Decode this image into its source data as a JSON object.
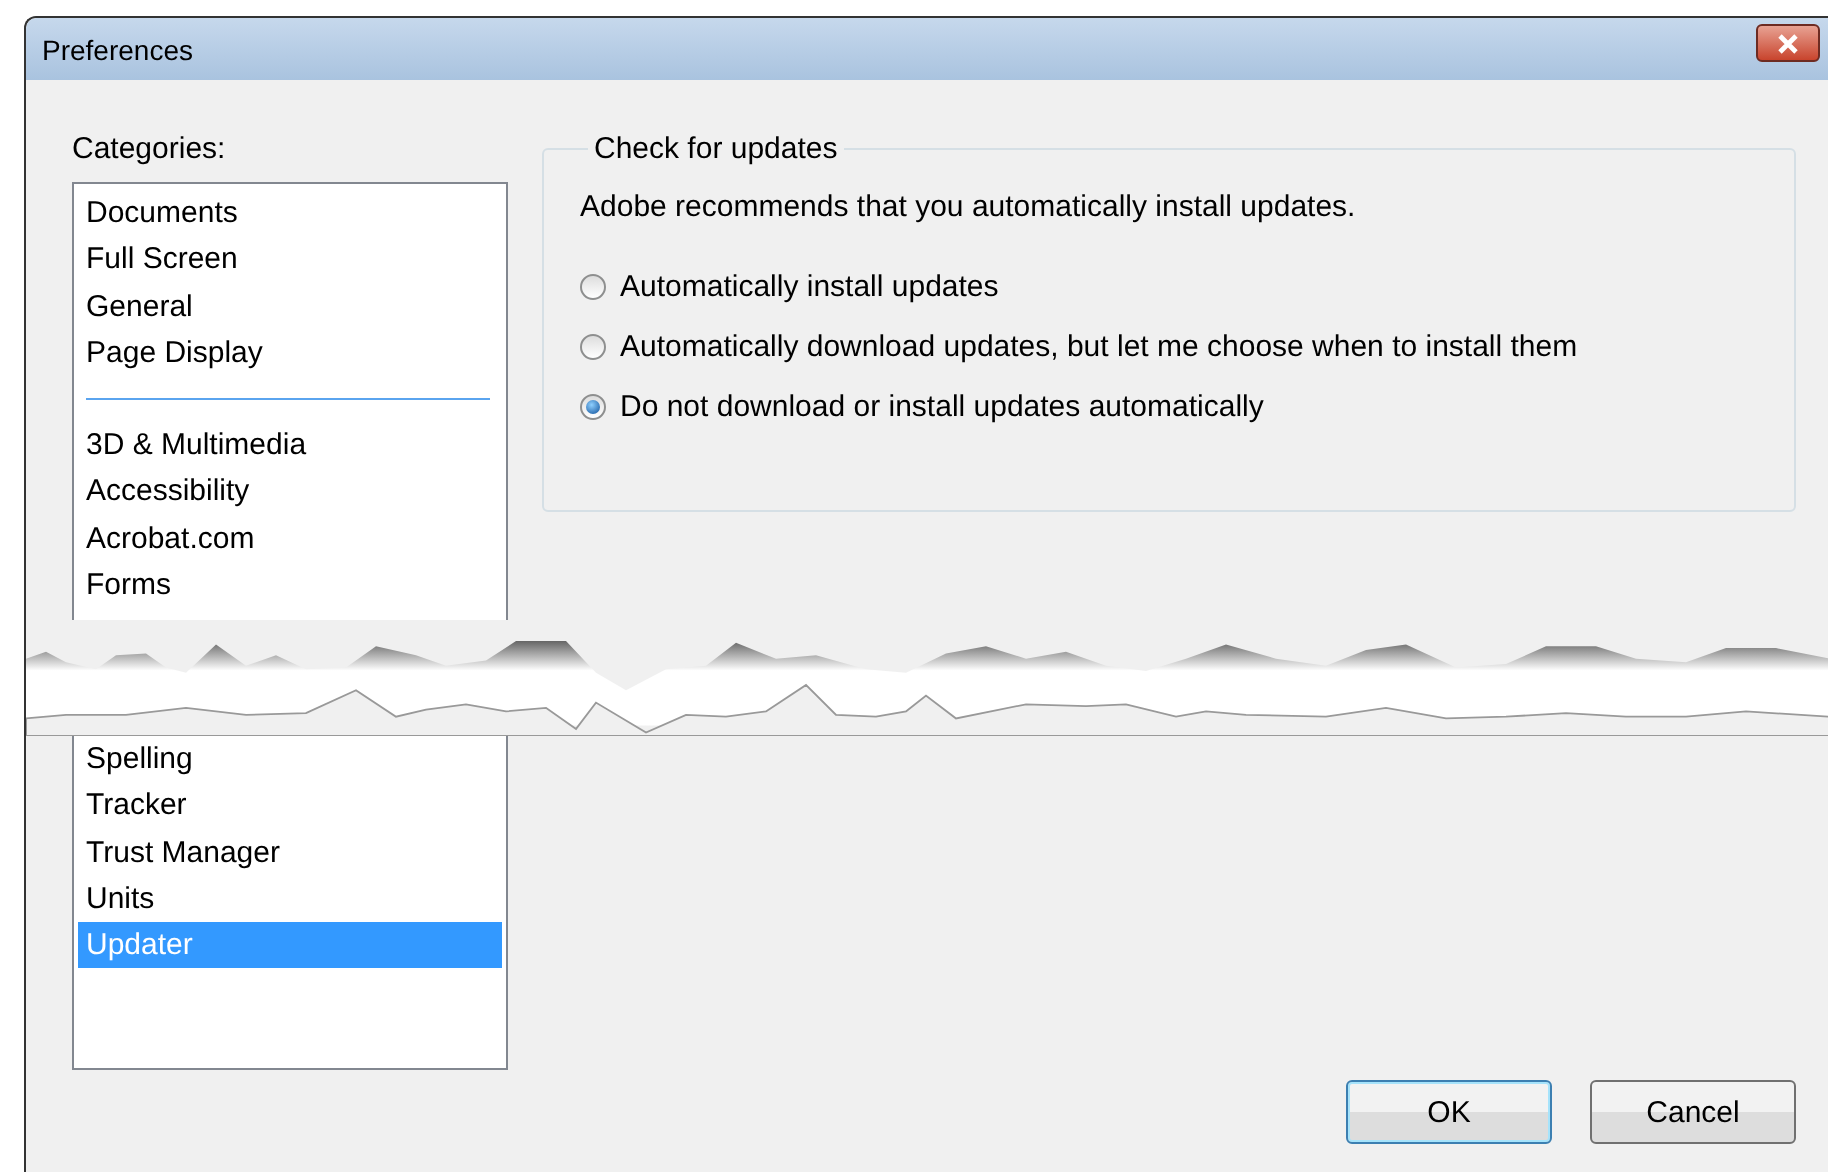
{
  "window": {
    "title": "Preferences"
  },
  "categories": {
    "label": "Categories:",
    "primary_items": [
      {
        "label": "Documents",
        "selected": false
      },
      {
        "label": "Full Screen",
        "selected": false
      },
      {
        "label": "General",
        "selected": false
      },
      {
        "label": "Page Display",
        "selected": false
      }
    ],
    "items_before_tear": [
      {
        "label": "3D & Multimedia",
        "selected": false
      },
      {
        "label": "Accessibility",
        "selected": false
      },
      {
        "label": "Acrobat.com",
        "selected": false
      },
      {
        "label": "Forms",
        "selected": false
      }
    ],
    "items_after_tear": [
      {
        "label": "Spelling",
        "selected": false
      },
      {
        "label": "Tracker",
        "selected": false
      },
      {
        "label": "Trust Manager",
        "selected": false
      },
      {
        "label": "Units",
        "selected": false
      },
      {
        "label": "Updater",
        "selected": true
      }
    ]
  },
  "update_group": {
    "title": "Check for updates",
    "description": "Adobe recommends that you automatically install updates.",
    "options": [
      {
        "label": "Automatically install updates",
        "selected": false
      },
      {
        "label": "Automatically download updates, but let me choose when to install them",
        "selected": false
      },
      {
        "label": "Do not download or install updates automatically",
        "selected": true
      }
    ]
  },
  "buttons": [
    {
      "label": "OK",
      "kind": "default"
    },
    {
      "label": "Cancel",
      "kind": "normal"
    }
  ]
}
